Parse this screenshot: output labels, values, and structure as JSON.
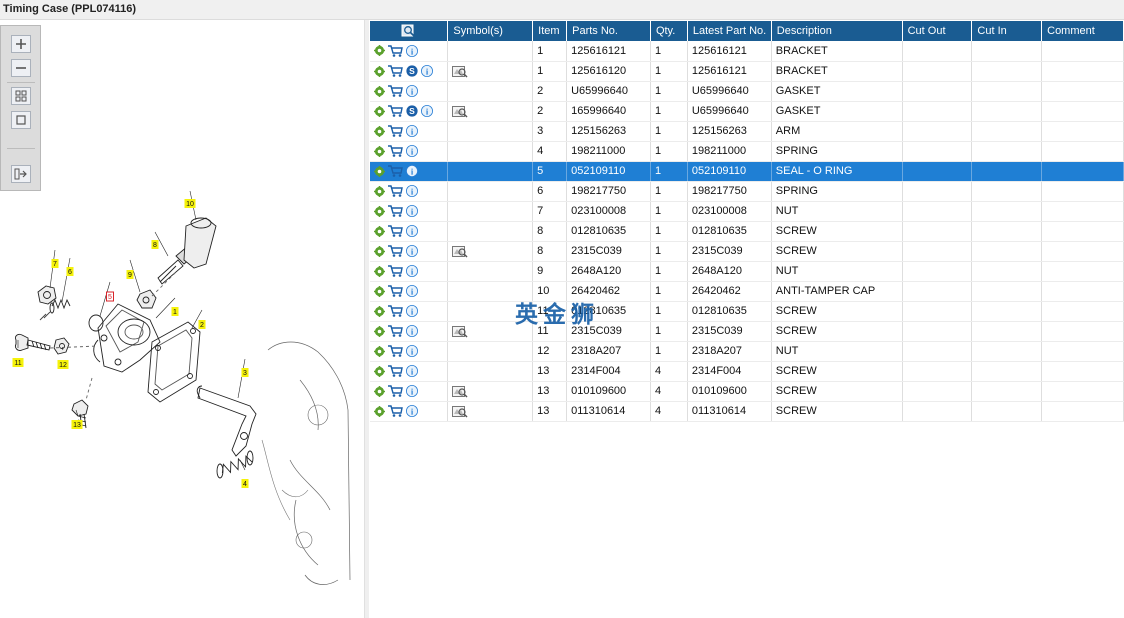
{
  "window": {
    "title": "Timing Case (PPL074116)"
  },
  "toolbar": {
    "buttons": [
      "zoom-in-icon",
      "zoom-out-icon",
      "fit-all-icon",
      "fit-page-icon",
      "export-icon"
    ]
  },
  "drawing": {
    "callouts": [
      "1",
      "2",
      "3",
      "4",
      "5",
      "6",
      "7",
      "8",
      "9",
      "10",
      "11",
      "12",
      "13"
    ],
    "highlighted_callout": "5"
  },
  "grid": {
    "columns": [
      "",
      "Symbol(s)",
      "Item",
      "Parts No.",
      "Qty.",
      "Latest Part No.",
      "Description",
      "Cut Out",
      "Cut In",
      "Comment"
    ],
    "selected_index": 6,
    "rows": [
      {
        "s": false,
        "sym": false,
        "item": "1",
        "part": "125616121",
        "qty": "1",
        "latest": "125616121",
        "desc": "BRACKET",
        "out": "",
        "in": "",
        "comment": ""
      },
      {
        "s": true,
        "sym": true,
        "item": "1",
        "part": "125616120",
        "qty": "1",
        "latest": "125616121",
        "desc": "BRACKET",
        "out": "",
        "in": "",
        "comment": ""
      },
      {
        "s": false,
        "sym": false,
        "item": "2",
        "part": "U65996640",
        "qty": "1",
        "latest": "U65996640",
        "desc": "GASKET",
        "out": "",
        "in": "",
        "comment": ""
      },
      {
        "s": true,
        "sym": true,
        "item": "2",
        "part": "165996640",
        "qty": "1",
        "latest": "U65996640",
        "desc": "GASKET",
        "out": "",
        "in": "",
        "comment": ""
      },
      {
        "s": false,
        "sym": false,
        "item": "3",
        "part": "125156263",
        "qty": "1",
        "latest": "125156263",
        "desc": "ARM",
        "out": "",
        "in": "",
        "comment": ""
      },
      {
        "s": false,
        "sym": false,
        "item": "4",
        "part": "198211000",
        "qty": "1",
        "latest": "198211000",
        "desc": "SPRING",
        "out": "",
        "in": "",
        "comment": ""
      },
      {
        "s": false,
        "sym": false,
        "item": "5",
        "part": "052109110",
        "qty": "1",
        "latest": "052109110",
        "desc": "SEAL - O RING",
        "out": "",
        "in": "",
        "comment": ""
      },
      {
        "s": false,
        "sym": false,
        "item": "6",
        "part": "198217750",
        "qty": "1",
        "latest": "198217750",
        "desc": "SPRING",
        "out": "",
        "in": "",
        "comment": ""
      },
      {
        "s": false,
        "sym": false,
        "item": "7",
        "part": "023100008",
        "qty": "1",
        "latest": "023100008",
        "desc": "NUT",
        "out": "",
        "in": "",
        "comment": ""
      },
      {
        "s": false,
        "sym": false,
        "item": "8",
        "part": "012810635",
        "qty": "1",
        "latest": "012810635",
        "desc": "SCREW",
        "out": "",
        "in": "",
        "comment": ""
      },
      {
        "s": false,
        "sym": true,
        "item": "8",
        "part": "2315C039",
        "qty": "1",
        "latest": "2315C039",
        "desc": "SCREW",
        "out": "",
        "in": "",
        "comment": ""
      },
      {
        "s": false,
        "sym": false,
        "item": "9",
        "part": "2648A120",
        "qty": "1",
        "latest": "2648A120",
        "desc": "NUT",
        "out": "",
        "in": "",
        "comment": ""
      },
      {
        "s": false,
        "sym": false,
        "item": "10",
        "part": "26420462",
        "qty": "1",
        "latest": "26420462",
        "desc": "ANTI-TAMPER CAP",
        "out": "",
        "in": "",
        "comment": ""
      },
      {
        "s": false,
        "sym": false,
        "item": "11",
        "part": "012810635",
        "qty": "1",
        "latest": "012810635",
        "desc": "SCREW",
        "out": "",
        "in": "",
        "comment": ""
      },
      {
        "s": false,
        "sym": true,
        "item": "11",
        "part": "2315C039",
        "qty": "1",
        "latest": "2315C039",
        "desc": "SCREW",
        "out": "",
        "in": "",
        "comment": ""
      },
      {
        "s": false,
        "sym": false,
        "item": "12",
        "part": "2318A207",
        "qty": "1",
        "latest": "2318A207",
        "desc": "NUT",
        "out": "",
        "in": "",
        "comment": ""
      },
      {
        "s": false,
        "sym": false,
        "item": "13",
        "part": "2314F004",
        "qty": "4",
        "latest": "2314F004",
        "desc": "SCREW",
        "out": "",
        "in": "",
        "comment": ""
      },
      {
        "s": false,
        "sym": true,
        "item": "13",
        "part": "010109600",
        "qty": "4",
        "latest": "010109600",
        "desc": "SCREW",
        "out": "",
        "in": "",
        "comment": ""
      },
      {
        "s": false,
        "sym": true,
        "item": "13",
        "part": "011310614",
        "qty": "4",
        "latest": "011310614",
        "desc": "SCREW",
        "out": "",
        "in": "",
        "comment": ""
      }
    ]
  },
  "watermark": "英金狮",
  "colors": {
    "header": "#1a5c92",
    "selected": "#1f7fd4",
    "gear": "#5aa02c",
    "cart": "#1b5fa8",
    "info": "#2a7fd6",
    "callout": "#f5f20a"
  }
}
